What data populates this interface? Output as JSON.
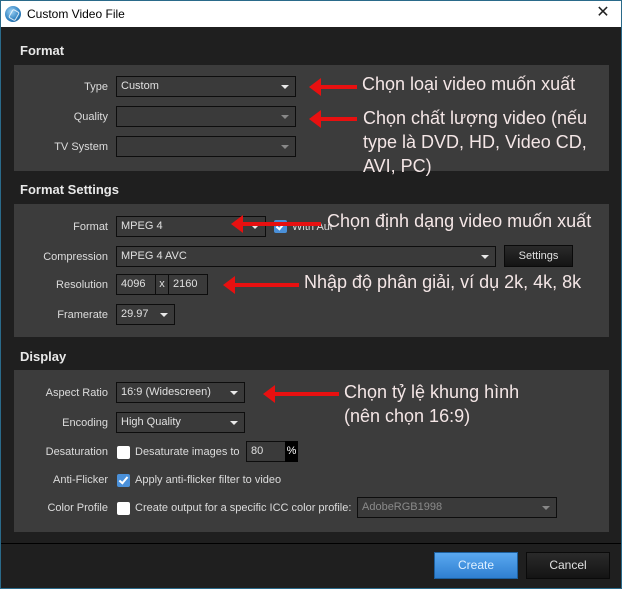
{
  "window": {
    "title": "Custom Video File",
    "app_icon": "app-logo-icon",
    "close_icon": "close-icon",
    "close_glyph": "✕"
  },
  "format": {
    "section_title": "Format",
    "type": {
      "label": "Type",
      "value": "Custom"
    },
    "quality": {
      "label": "Quality",
      "value": ""
    },
    "tv_system": {
      "label": "TV System",
      "value": ""
    }
  },
  "format_settings": {
    "section_title": "Format Settings",
    "format": {
      "label": "Format",
      "value": "MPEG 4"
    },
    "with_audio": {
      "label": "With Audio",
      "checked": true
    },
    "compression": {
      "label": "Compression",
      "value": "MPEG 4 AVC"
    },
    "settings_button": "Settings",
    "resolution": {
      "label": "Resolution",
      "width": "4096",
      "separator": "x",
      "height": "2160"
    },
    "framerate": {
      "label": "Framerate",
      "value": "29.97"
    }
  },
  "display": {
    "section_title": "Display",
    "aspect_ratio": {
      "label": "Aspect Ratio",
      "value": "16:9 (Widescreen)"
    },
    "encoding": {
      "label": "Encoding",
      "value": "High Quality"
    },
    "desaturation": {
      "label": "Desaturation",
      "checkbox_text": "Desaturate images to",
      "checked": false,
      "value": "80",
      "unit": "%"
    },
    "anti_flicker": {
      "label": "Anti-Flicker",
      "checkbox_text": "Apply anti-flicker filter to video",
      "checked": true
    },
    "color_profile": {
      "label": "Color Profile",
      "checkbox_text": "Create output for a specific ICC color profile:",
      "checked": false,
      "value": "AdobeRGB1998"
    }
  },
  "footer": {
    "create": "Create",
    "cancel": "Cancel"
  },
  "annotations": {
    "type": "Chọn loại video muốn xuất",
    "quality_line1": "Chọn chất lượng video (nếu",
    "quality_line2": "type là DVD, HD, Video CD,",
    "quality_line3": "AVI, PC)",
    "format": "Chọn định dạng video muốn xuất",
    "resolution": "Nhập độ phân giải, ví dụ 2k, 4k, 8k",
    "aspect_line1": "Chọn tỷ lệ khung hình",
    "aspect_line2": "(nên chọn 16:9)"
  },
  "colors": {
    "accent": "#3f8fe0",
    "annotation_arrow": "#e81010",
    "panel": "#3c3c3c",
    "background": "#1f1f1f"
  }
}
